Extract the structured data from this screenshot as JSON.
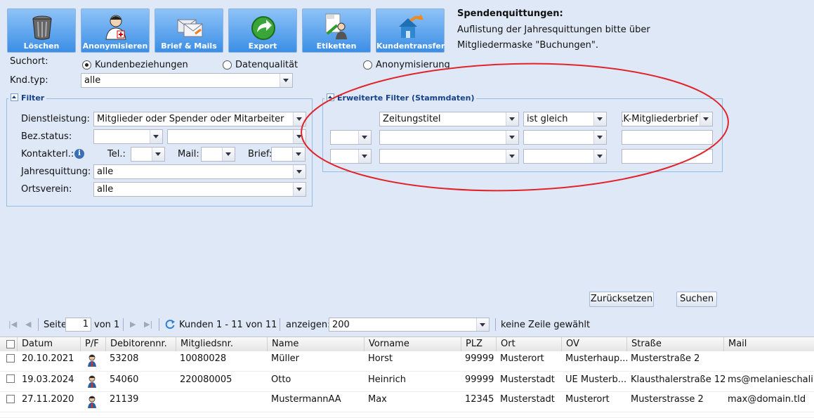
{
  "toolbar": {
    "buttons": [
      {
        "label": "Löschen",
        "icon": "trash-icon"
      },
      {
        "label": "Anonymisieren",
        "icon": "anonymize-user-icon"
      },
      {
        "label": "Brief & Mails",
        "icon": "envelope-icon"
      },
      {
        "label": "Export",
        "icon": "export-arrow-icon"
      },
      {
        "label": "Etiketten",
        "icon": "labels-icon"
      },
      {
        "label": "Kundentransfer",
        "icon": "house-transfer-icon"
      }
    ]
  },
  "info": {
    "title": "Spendenquittungen:",
    "line1": "Auflistung der Jahresquittungen bitte über",
    "line2": "Mitgliedermaske \"Buchungen\"."
  },
  "search_location": {
    "label": "Suchort:",
    "options": [
      "Kundenbeziehungen",
      "Datenqualität",
      "Anonymisierung"
    ],
    "selected": "Kundenbeziehungen"
  },
  "customer_type": {
    "label": "Knd.typ:",
    "value": "alle"
  },
  "filter": {
    "legend": "Filter",
    "service_label": "Dienstleistung:",
    "service_value": "Mitglieder oder Spender oder Mitarbeiter",
    "status_label": "Bez.status:",
    "contact_label": "Kontakterl.:",
    "tel_label": "Tel.:",
    "mail_label": "Mail:",
    "letter_label": "Brief:",
    "receipt_label": "Jahresquittung:",
    "receipt_value": "alle",
    "branch_label": "Ortsverein:",
    "branch_value": "alle"
  },
  "extended_filter": {
    "legend": "Erweiterte Filter (Stammdaten)",
    "rows": [
      {
        "logic": "",
        "field": "Zeitungstitel",
        "operator": "ist gleich",
        "value": "DRK-Mitgliederbrief"
      },
      {
        "logic": "",
        "field": "",
        "operator": "",
        "value": ""
      },
      {
        "logic": "",
        "field": "",
        "operator": "",
        "value": ""
      }
    ]
  },
  "actions": {
    "reset": "Zurücksetzen",
    "search": "Suchen"
  },
  "paging": {
    "page_label": "Seite",
    "page": "1",
    "of_label": "von 1",
    "summary": "Kunden 1 - 11 von 11",
    "show_label": "anzeigen:",
    "page_size": "200",
    "selection": "keine Zeile gewählt"
  },
  "grid": {
    "columns": [
      "Datum",
      "P/F",
      "Debitorennr.",
      "Mitgliedsnr.",
      "Name",
      "Vorname",
      "PLZ",
      "Ort",
      "OV",
      "Straße",
      "Mail"
    ],
    "rows": [
      {
        "datum": "20.10.2021",
        "debitor": "53208",
        "mitglied": "10080028",
        "name": "Müller",
        "vorname": "Horst",
        "plz": "99999",
        "ort": "Musterort",
        "ov": "Musterhaup...",
        "strasse": "Musterstraße 2",
        "mail": ""
      },
      {
        "datum": "19.03.2024",
        "debitor": "54060",
        "mitglied": "220080005",
        "name": "Otto",
        "vorname": "Heinrich",
        "plz": "99999",
        "ort": "Musterstadt",
        "ov": "UE Musterb...",
        "strasse": "Klausthalerstraße 12",
        "mail": "ms@melanieschalin..."
      },
      {
        "datum": "27.11.2020",
        "debitor": "21139",
        "mitglied": "",
        "name": "MustermannAA",
        "vorname": "Max",
        "plz": "12345",
        "ort": "Musterstadt",
        "ov": "Musterort",
        "strasse": "Musterstrasse 2",
        "mail": "max@domain.tld"
      }
    ]
  },
  "colors": {
    "accent_red": "#e0242a",
    "toolbar_blue": "#3b8ee6",
    "legend_blue": "#15428b"
  }
}
